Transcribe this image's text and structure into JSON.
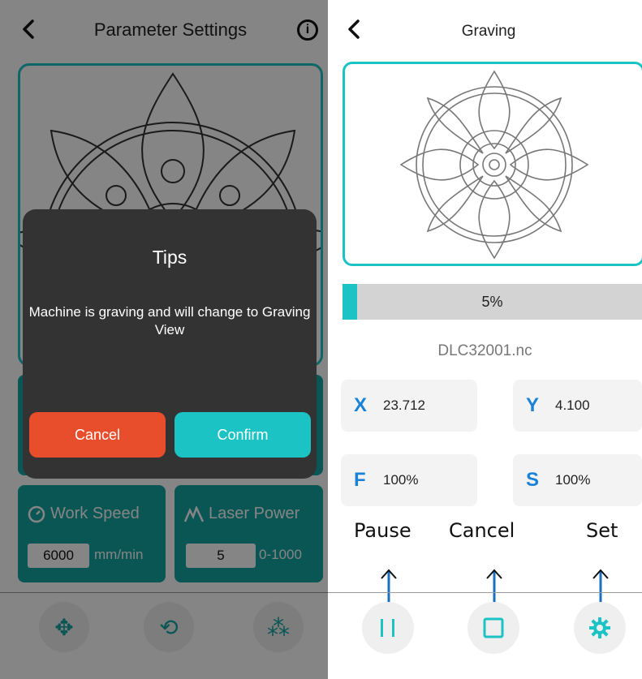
{
  "left_screen": {
    "header": {
      "title": "Parameter Settings",
      "back_icon": "chevron-left-icon",
      "info_icon": "info-circle-icon",
      "info_glyph": "i"
    },
    "work_speed": {
      "label": "Work Speed",
      "icon": "speedometer-icon",
      "value": "6000",
      "unit": "mm/min"
    },
    "laser_power": {
      "label": "Laser Power",
      "icon": "laser-power-icon",
      "value": "5",
      "range": "0-1000"
    },
    "bottom_toolbar": [
      {
        "name": "move-icon",
        "glyph": "✥"
      },
      {
        "name": "frame-icon",
        "glyph": "⟲"
      },
      {
        "name": "focus-laser-icon",
        "glyph": "⁂"
      }
    ],
    "dialog": {
      "title": "Tips",
      "message": "Machine is graving and will change to Graving View",
      "cancel_label": "Cancel",
      "confirm_label": "Confirm"
    }
  },
  "right_screen": {
    "header": {
      "title": "Graving",
      "back_icon": "chevron-left-icon"
    },
    "progress": {
      "value": 0.05,
      "label": "5%"
    },
    "filename": "DLC32001.nc",
    "coords": [
      {
        "axis": "X",
        "value": "23.712"
      },
      {
        "axis": "Y",
        "value": "4.100"
      },
      {
        "axis": "F",
        "value": "100%"
      },
      {
        "axis": "S",
        "value": "100%"
      }
    ],
    "annotations": {
      "pause": "Pause",
      "cancel": "Cancel",
      "set": "Set"
    },
    "bottom_toolbar": [
      {
        "name": "pause-icon"
      },
      {
        "name": "stop-icon"
      },
      {
        "name": "gear-icon"
      }
    ]
  },
  "colors": {
    "accent": "#1cc3c4",
    "accent_dark": "#13a6a4",
    "cancel": "#e84e2b",
    "axis_letter": "#1a82d6",
    "arrow": "#1a6fbf"
  }
}
